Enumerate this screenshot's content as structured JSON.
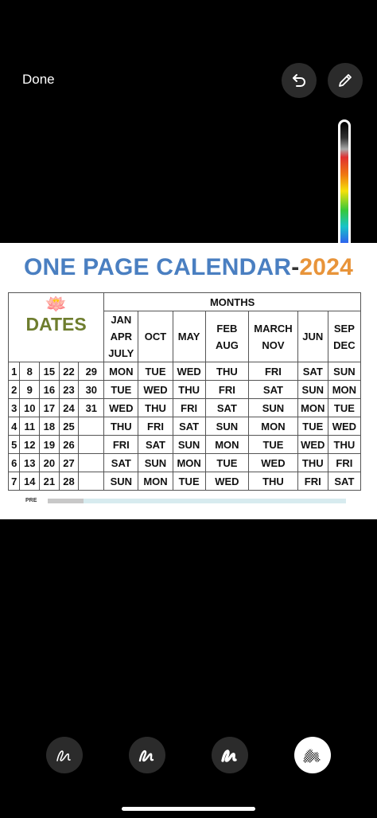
{
  "toolbar": {
    "done_label": "Done",
    "undo_icon": "undo-icon",
    "pen_icon": "pen-icon"
  },
  "calendar": {
    "title_main": "ONE PAGE CALENDAR",
    "title_dash": "-",
    "title_year": "2024",
    "months_label": "MONTHS",
    "dates_label": "DATES",
    "month_groups": [
      {
        "lines": [
          "JAN",
          "APR",
          "JULY"
        ]
      },
      {
        "lines": [
          "OCT"
        ]
      },
      {
        "lines": [
          "MAY"
        ]
      },
      {
        "lines": [
          "FEB",
          "AUG"
        ]
      },
      {
        "lines": [
          "MARCH",
          "NOV"
        ]
      },
      {
        "lines": [
          "JUN"
        ]
      },
      {
        "lines": [
          "SEP",
          "DEC"
        ]
      }
    ],
    "rows": [
      {
        "dates": [
          "1",
          "8",
          "15",
          "22",
          "29"
        ],
        "days": [
          "MON",
          "TUE",
          "WED",
          "THU",
          "FRI",
          "SAT",
          "SUN"
        ]
      },
      {
        "dates": [
          "2",
          "9",
          "16",
          "23",
          "30"
        ],
        "days": [
          "TUE",
          "WED",
          "THU",
          "FRI",
          "SAT",
          "SUN",
          "MON"
        ]
      },
      {
        "dates": [
          "3",
          "10",
          "17",
          "24",
          "31"
        ],
        "days": [
          "WED",
          "THU",
          "FRI",
          "SAT",
          "SUN",
          "MON",
          "TUE"
        ]
      },
      {
        "dates": [
          "4",
          "11",
          "18",
          "25",
          ""
        ],
        "days": [
          "THU",
          "FRI",
          "SAT",
          "SUN",
          "MON",
          "TUE",
          "WED"
        ]
      },
      {
        "dates": [
          "5",
          "12",
          "19",
          "26",
          ""
        ],
        "days": [
          "FRI",
          "SAT",
          "SUN",
          "MON",
          "TUE",
          "WED",
          "THU"
        ]
      },
      {
        "dates": [
          "6",
          "13",
          "20",
          "27",
          ""
        ],
        "days": [
          "SAT",
          "SUN",
          "MON",
          "TUE",
          "WED",
          "THU",
          "FRI"
        ]
      },
      {
        "dates": [
          "7",
          "14",
          "21",
          "28",
          ""
        ],
        "days": [
          "SUN",
          "MON",
          "TUE",
          "WED",
          "THU",
          "FRI",
          "SAT"
        ]
      }
    ],
    "footer_text": "PRE"
  },
  "markup_tools": [
    "pen-tool-icon",
    "marker-tool-icon",
    "pencil-tool-icon",
    "eraser-tool-icon"
  ],
  "colors": {
    "sunday": "#d12a2a",
    "month_header": "#1f9a56",
    "title_blue": "#4a7fc1",
    "year_orange": "#e8943a"
  }
}
